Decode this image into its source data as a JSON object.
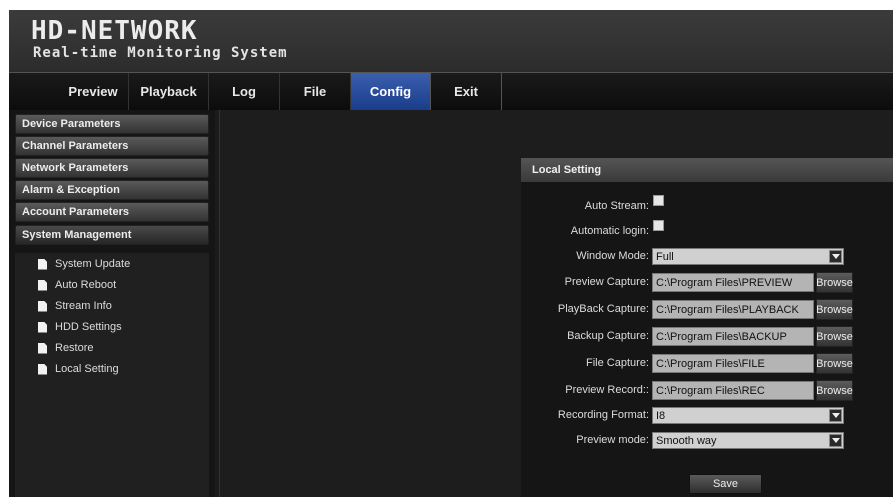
{
  "header": {
    "title": "HD-NETWORK",
    "subtitle": "Real-time Monitoring System"
  },
  "nav": {
    "tabs": [
      "Preview",
      "Playback",
      "Log",
      "File",
      "Config",
      "Exit"
    ],
    "active": "Config"
  },
  "sidebar": {
    "sections": [
      "Device Parameters",
      "Channel Parameters",
      "Network Parameters",
      "Alarm & Exception",
      "Account Parameters",
      "System Management"
    ],
    "open_section": "System Management",
    "items": [
      {
        "label": "System Update",
        "icon": "document-icon"
      },
      {
        "label": "Auto Reboot",
        "icon": "document-icon"
      },
      {
        "label": "Stream Info",
        "icon": "document-icon"
      },
      {
        "label": "HDD Settings",
        "icon": "document-icon"
      },
      {
        "label": "Restore",
        "icon": "document-icon"
      },
      {
        "label": "Local Setting",
        "icon": "document-icon"
      }
    ]
  },
  "local_setting": {
    "title": "Local Setting",
    "auto_stream": {
      "label": "Auto Stream:",
      "checked": false
    },
    "automatic_login": {
      "label": "Automatic login:",
      "checked": false
    },
    "window_mode": {
      "label": "Window Mode:",
      "value": "Full"
    },
    "preview_capture": {
      "label": "Preview Capture:",
      "value": "C:\\Program Files\\PREVIEW"
    },
    "playback_capture": {
      "label": "PlayBack Capture:",
      "value": "C:\\Program Files\\PLAYBACK"
    },
    "backup_capture": {
      "label": "Backup Capture:",
      "value": "C:\\Program Files\\BACKUP"
    },
    "file_capture": {
      "label": "File Capture:",
      "value": "C:\\Program Files\\FILE"
    },
    "preview_record": {
      "label": "Preview Record::",
      "value": "C:\\Program Files\\REC"
    },
    "recording_format": {
      "label": "Recording Format:",
      "value": "I8"
    },
    "preview_mode": {
      "label": "Preview mode:",
      "value": "Smooth way"
    },
    "browse_label": "Browse",
    "save_label": "Save"
  },
  "colors": {
    "active_tab": "#2c4f9c",
    "background": "#1b1b1b"
  }
}
